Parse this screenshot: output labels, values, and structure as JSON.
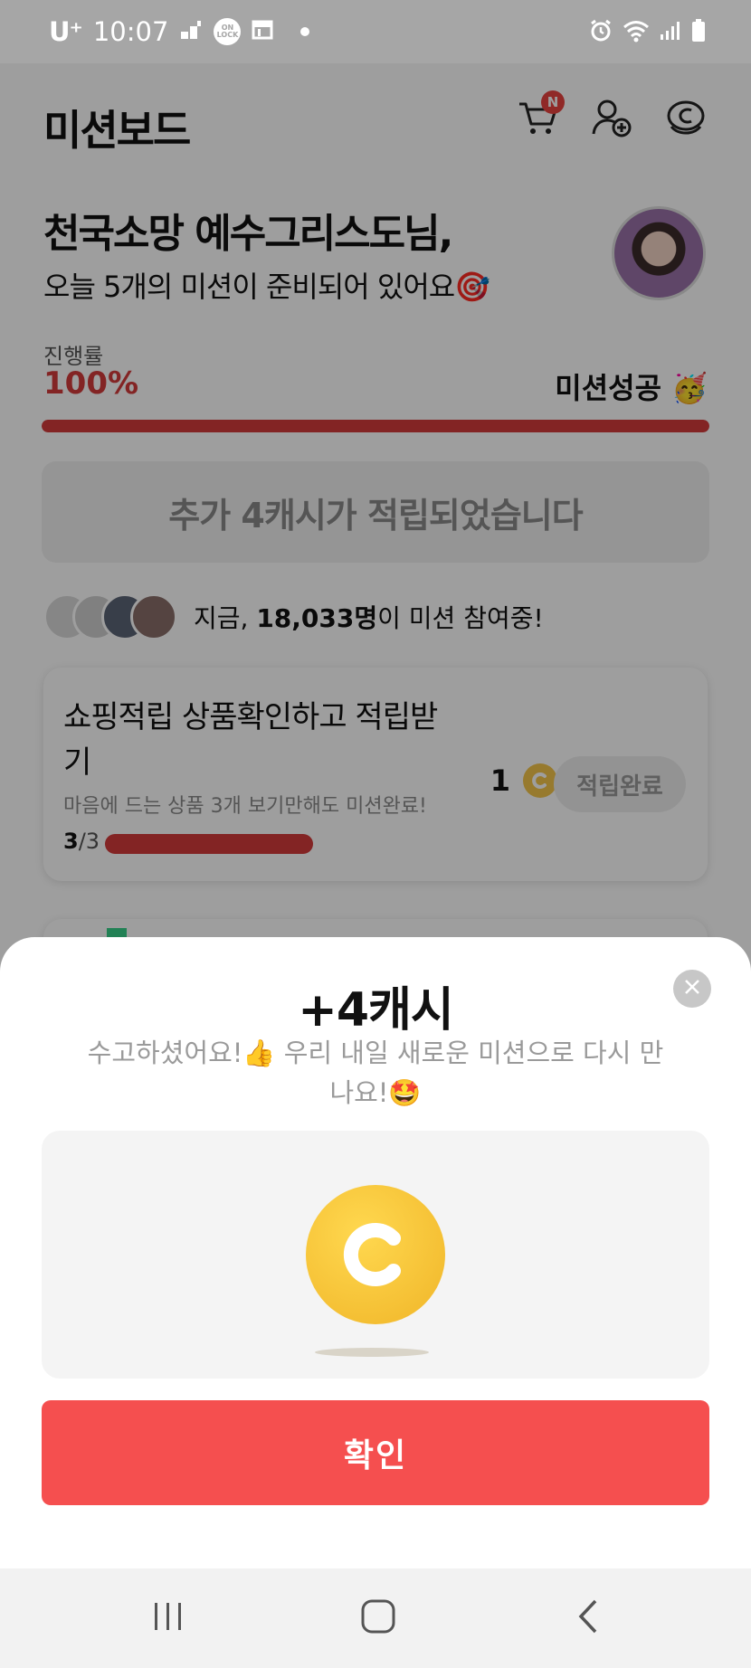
{
  "status_bar": {
    "carrier": "U⁺",
    "time": "10:07"
  },
  "header": {
    "title": "미션보드",
    "cart_badge": "N"
  },
  "greeting": {
    "name": "천국소망 예수그리스도님,",
    "subtitle": "오늘 5개의 미션이 준비되어 있어요🎯"
  },
  "progress": {
    "label": "진행률",
    "value": "100%",
    "percent": 100,
    "status": "미션성공 🥳"
  },
  "cash_banner": {
    "text": "추가 4캐시가 적립되었습니다"
  },
  "participants": {
    "prefix": "지금, ",
    "count": "18,033명",
    "suffix": "이 미션 참여중!"
  },
  "mission": {
    "title": "쇼핑적립 상품확인하고 적립받기",
    "description": "마음에 드는 상품 3개 보기만해도 미션완료!",
    "count_done": "3",
    "count_total": "/3",
    "progress_fraction": 1.0,
    "reward": "1",
    "button_label": "적립완료"
  },
  "sheet": {
    "title": "+4캐시",
    "message": "수고하셨어요!👍 우리 내일 새로운 미션으로 다시 만나요!🤩",
    "confirm_label": "확인"
  },
  "colors": {
    "accent_red": "#f54f4f",
    "progress_red": "#d33a3a",
    "coin_yellow": "#f4c64b"
  },
  "icons": [
    "cart-icon",
    "add-friend-icon",
    "cash-icon",
    "close-icon",
    "coin-icon",
    "recent-apps-icon",
    "home-icon",
    "back-icon"
  ]
}
